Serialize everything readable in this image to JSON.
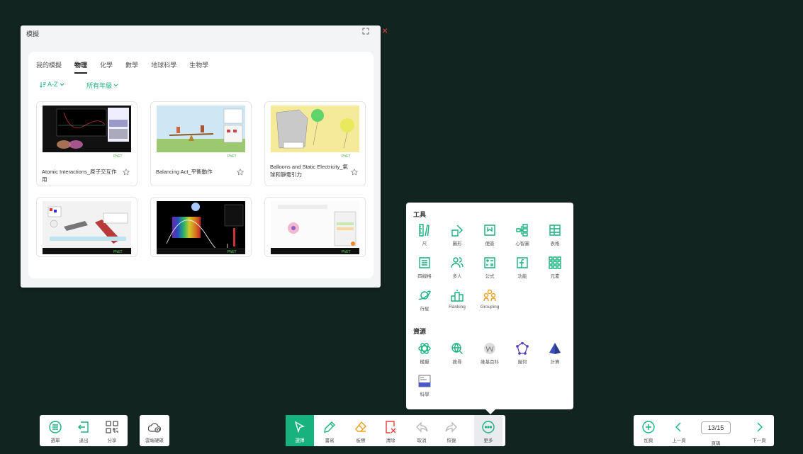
{
  "simulation": {
    "title": "模擬",
    "tabs": [
      "我的模擬",
      "物理",
      "化學",
      "數學",
      "地球科學",
      "生物學"
    ],
    "active_tab": "物理",
    "sort_label": "A-Z",
    "grade_label": "所有年級",
    "cards": [
      {
        "title": "Atomic Interactions_原子交互作用"
      },
      {
        "title": "Balancing Act_平衡動作"
      },
      {
        "title": "Balloons and Static Electricity_氣球和靜電引力"
      },
      {
        "title": ""
      },
      {
        "title": ""
      },
      {
        "title": ""
      }
    ]
  },
  "tools_popup": {
    "tools_heading": "工具",
    "tools": [
      "尺",
      "圖形",
      "便簽",
      "心智圖",
      "表格",
      "四線格",
      "多人",
      "公式",
      "功能",
      "元素",
      "行星",
      "Ranking",
      "Grouping"
    ],
    "resources_heading": "資源",
    "resources": [
      "模擬",
      "搜尋",
      "維基百科",
      "幾何",
      "計算",
      "科學"
    ]
  },
  "left_bar": {
    "menu": "選單",
    "exit": "退出",
    "share": "分享",
    "cloud": "雲端硬碟"
  },
  "center_bar": {
    "select": "選擇",
    "pen": "書寫",
    "eraser": "板擦",
    "clear": "清除",
    "undo": "取消",
    "redo": "恢復",
    "more": "更多"
  },
  "right_bar": {
    "add": "加頁",
    "prev": "上一頁",
    "pages": "頁碼",
    "next": "下一頁",
    "page_indicator": "13/15"
  },
  "colors": {
    "background": "#122420",
    "accent": "#18b27e",
    "close": "#e0403c"
  }
}
